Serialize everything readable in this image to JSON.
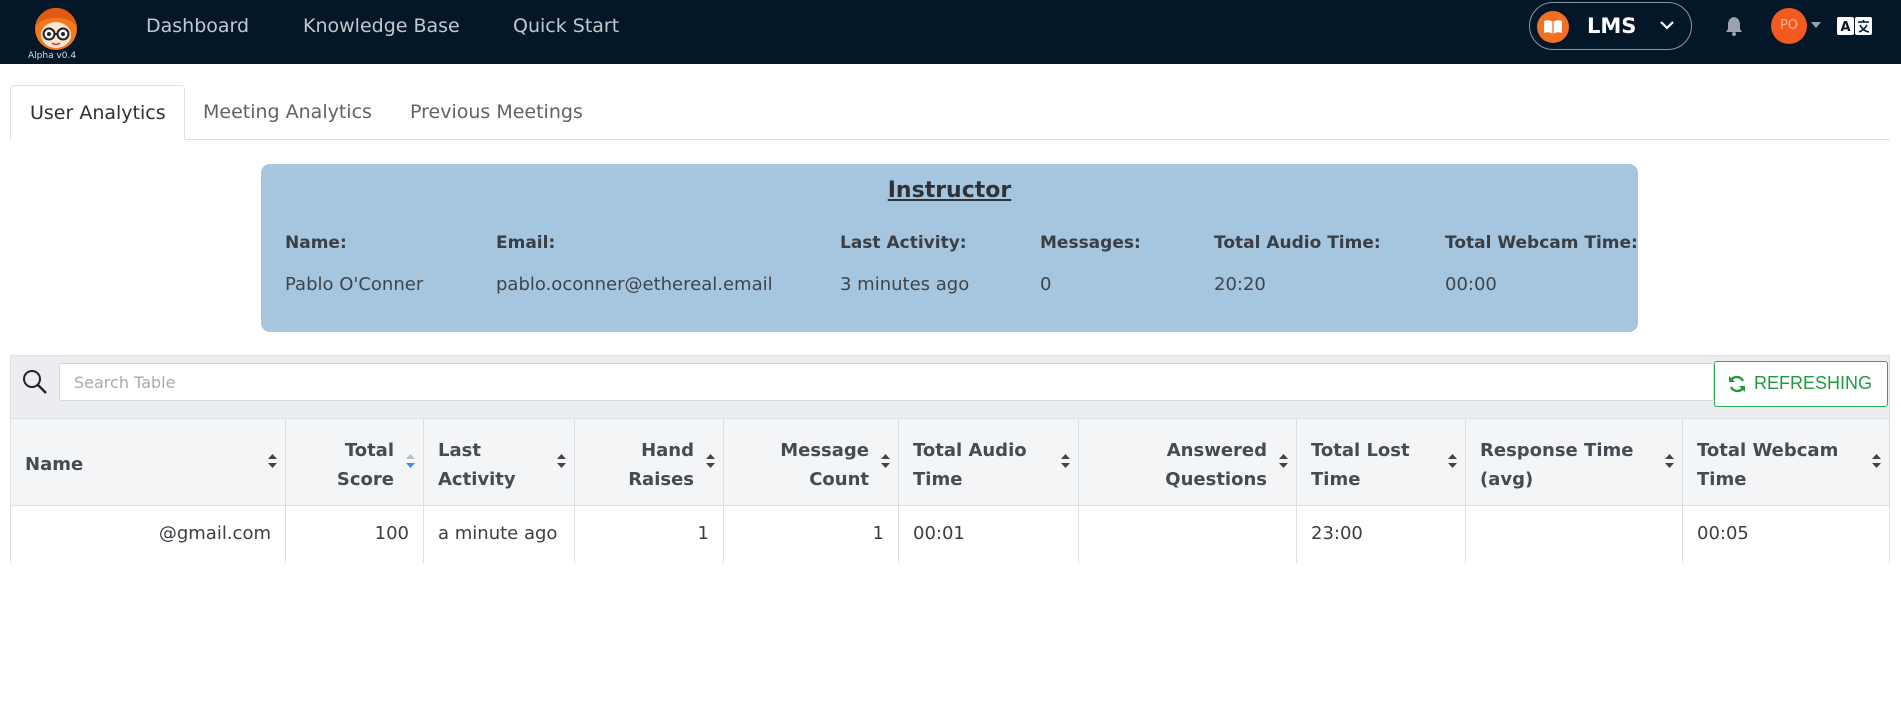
{
  "app": {
    "version": "Alpha v0.4",
    "nav": [
      "Dashboard",
      "Knowledge Base",
      "Quick Start"
    ],
    "product": "LMS",
    "avatar_initials": "PO",
    "brand_orange": "#f36f21",
    "topbar_color": "#031729"
  },
  "tabs": [
    "User Analytics",
    "Meeting Analytics",
    "Previous Meetings"
  ],
  "active_tab": "User Analytics",
  "instructor": {
    "title": "Instructor",
    "headers": [
      "Name:",
      "Email:",
      "Last Activity:",
      "Messages:",
      "Total Audio Time:",
      "Total Webcam Time:"
    ],
    "values": [
      "Pablo O'Conner",
      "pablo.oconner@ethereal.email",
      "3 minutes ago",
      "0",
      "20:20",
      "00:00"
    ],
    "card_color": "#a6c6e0"
  },
  "table": {
    "search_placeholder": "Search Table",
    "refresh_label": "REFRESHING",
    "columns": [
      "Name",
      "Total\nScore",
      "Last\nActivity",
      "Hand\nRaises",
      "Message\nCount",
      "Total Audio\nTime",
      "Answered\nQuestions",
      "Total Lost\nTime",
      "Response Time\n(avg)",
      "Total Webcam\nTime"
    ],
    "sorted_column": "Total Score",
    "rows": [
      [
        "@gmail.com",
        "100",
        "a minute ago",
        "1",
        "1",
        "00:01",
        "",
        "23:00",
        "",
        "00:05"
      ]
    ]
  }
}
